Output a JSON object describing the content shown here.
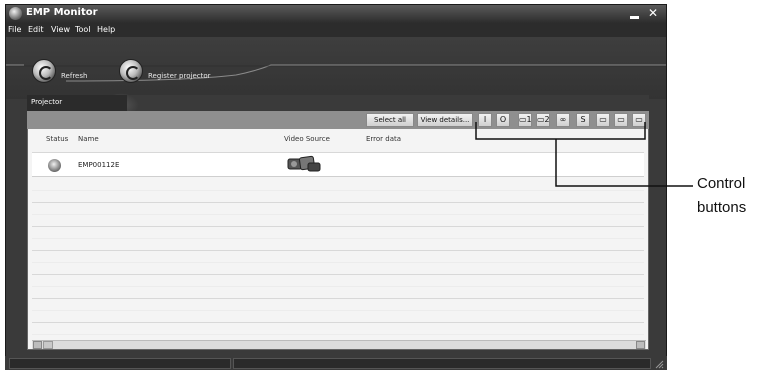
{
  "window": {
    "title": "EMP Monitor",
    "minimize_glyph": "",
    "close_glyph": "✕"
  },
  "menu": [
    "File",
    "Edit",
    "View",
    "Tool",
    "Help"
  ],
  "toolbar": {
    "refresh_label": "Refresh",
    "register_label": "Register projector"
  },
  "panel": {
    "tab_label": "Projector",
    "select_all_label": "Select all",
    "view_details_label": "View details...",
    "control_buttons": [
      {
        "icon": "power-on-icon",
        "glyph": "I"
      },
      {
        "icon": "power-off-icon",
        "glyph": "O"
      },
      {
        "icon": "computer1-source-icon",
        "glyph": "▭1"
      },
      {
        "icon": "computer2-source-icon",
        "glyph": "▭2"
      },
      {
        "icon": "video-source-icon",
        "glyph": "∞"
      },
      {
        "icon": "s-video-source-icon",
        "glyph": "S"
      },
      {
        "icon": "video-mute-icon",
        "glyph": "▭"
      },
      {
        "icon": "audio-mute-icon",
        "glyph": "▭"
      },
      {
        "icon": "freeze-icon",
        "glyph": "▭"
      }
    ]
  },
  "table": {
    "columns": [
      "Status",
      "Name",
      "Video Source",
      "Error data"
    ],
    "rows": [
      {
        "status_icon": "status-orb-icon",
        "name": "EMP00112E",
        "video_source_icon": "video-source-image-icon",
        "error_data": ""
      }
    ]
  },
  "callout": {
    "line1": "Control",
    "line2": "buttons"
  },
  "colors": {
    "window_bg": "#3a3a3a",
    "panel_bg": "#f4f4f4",
    "row_selected": "#ffffff"
  }
}
